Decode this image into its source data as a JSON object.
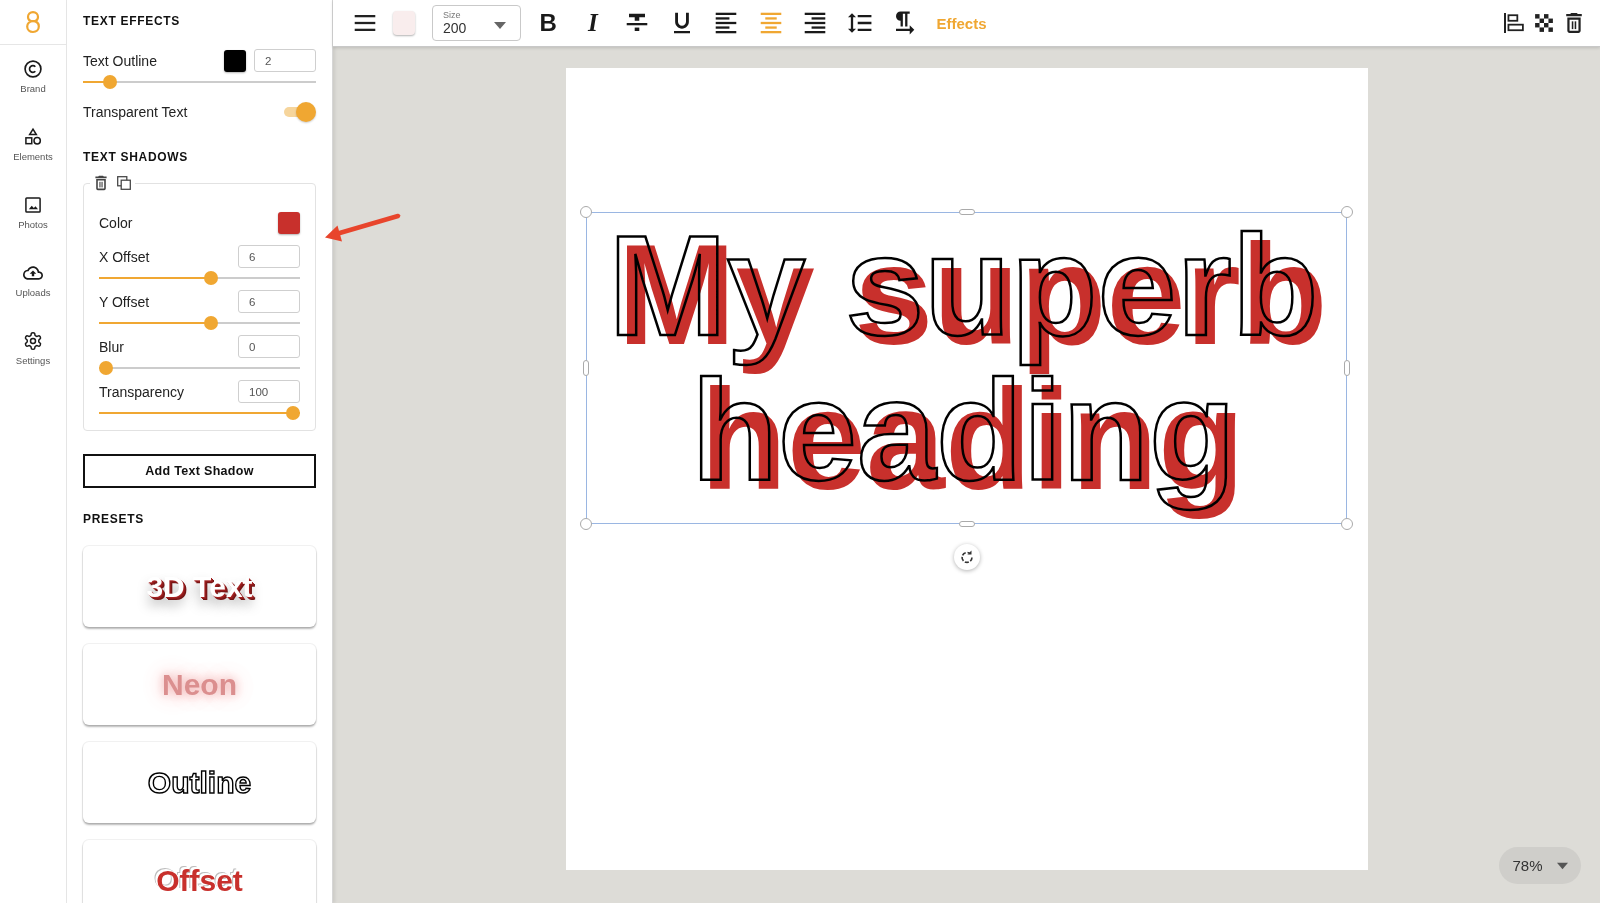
{
  "rail": {
    "items": [
      {
        "kind": "copyright",
        "label": "Brand"
      },
      {
        "kind": "shapes",
        "label": "Elements"
      },
      {
        "kind": "image",
        "label": "Photos"
      },
      {
        "kind": "upload",
        "label": "Uploads"
      },
      {
        "kind": "gear",
        "label": "Settings"
      }
    ]
  },
  "panel": {
    "text_effects": {
      "heading": "TEXT EFFECTS",
      "outline": {
        "label": "Text Outline",
        "color": "#000000",
        "value": "2",
        "level": 0.09
      },
      "transparent_text": {
        "label": "Transparent Text",
        "on": true
      }
    },
    "text_shadows": {
      "heading": "TEXT SHADOWS",
      "shadows": [
        {
          "color_label": "Color",
          "color": "#c8302c",
          "fields": [
            {
              "kind": "x_offset",
              "label": "X Offset",
              "value": "6",
              "level": 0.56
            },
            {
              "kind": "y_offset",
              "label": "Y Offset",
              "value": "6",
              "level": 0.56
            },
            {
              "kind": "blur",
              "label": "Blur",
              "value": "0",
              "level": 0
            },
            {
              "kind": "transparency",
              "label": "Transparency",
              "value": "100",
              "level": 1
            }
          ]
        }
      ],
      "add_button": "Add Text Shadow"
    },
    "presets": {
      "heading": "PRESETS",
      "items": [
        {
          "kind": "extruded",
          "label": "3D Text"
        },
        {
          "kind": "neon",
          "label": "Neon"
        },
        {
          "kind": "outline",
          "label": "Outline"
        },
        {
          "kind": "offset",
          "label": "Offset"
        }
      ]
    }
  },
  "toolbar": {
    "color_swatch": {
      "color": "#f9eded"
    },
    "size": {
      "label": "Size",
      "value": "200"
    },
    "tools": [
      {
        "kind": "bold",
        "label": "B",
        "selected": false
      },
      {
        "kind": "italic",
        "label": "I",
        "selected": false
      },
      {
        "kind": "strikethrough",
        "selected": false
      },
      {
        "kind": "underline",
        "selected": false
      },
      {
        "kind": "align-left",
        "selected": false
      },
      {
        "kind": "align-center",
        "selected": true
      },
      {
        "kind": "align-right",
        "selected": false
      },
      {
        "kind": "line-spacing",
        "selected": false
      },
      {
        "kind": "text-direction",
        "selected": false
      }
    ],
    "effects": {
      "label": "Effects",
      "selected": true
    },
    "right_tools": [
      {
        "kind": "align-objects"
      },
      {
        "kind": "transparency"
      },
      {
        "kind": "delete"
      }
    ]
  },
  "canvas": {
    "text": "My superb heading",
    "zoom": "78%"
  }
}
